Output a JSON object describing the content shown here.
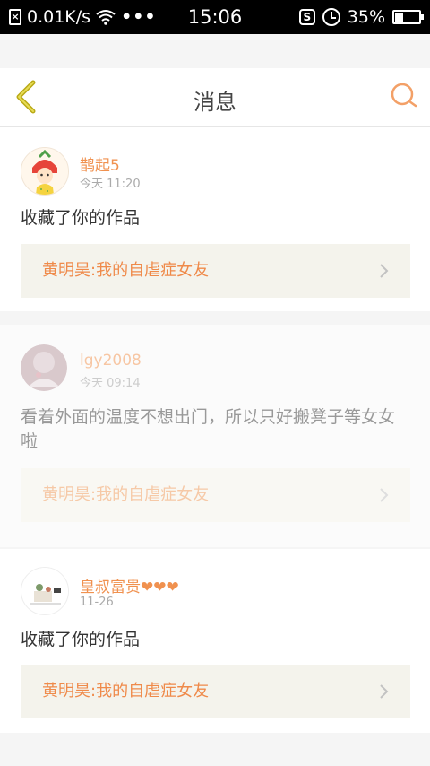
{
  "status_bar": {
    "speed": "0.01K/s",
    "dots": "•••",
    "time": "15:06",
    "battery": "35%",
    "battery_level": 0.35
  },
  "nav": {
    "title": "消息"
  },
  "messages": [
    {
      "username": "鹊起5",
      "time": "今天 11:20",
      "text": "收藏了你的作品",
      "ref": "黄明昊:我的自虐症女友"
    },
    {
      "username": "lgy2008",
      "time": "今天 09:14",
      "text": "看着外面的温度不想出门，所以只好搬凳子等女女啦",
      "ref": "黄明昊:我的自虐症女友"
    },
    {
      "username": "皇叔富贵❤❤❤",
      "time": "11-26",
      "text": "收藏了你的作品",
      "ref": "黄明昊:我的自虐症女友"
    }
  ],
  "colors": {
    "accent": "#f0914f",
    "back": "#b9a915"
  }
}
